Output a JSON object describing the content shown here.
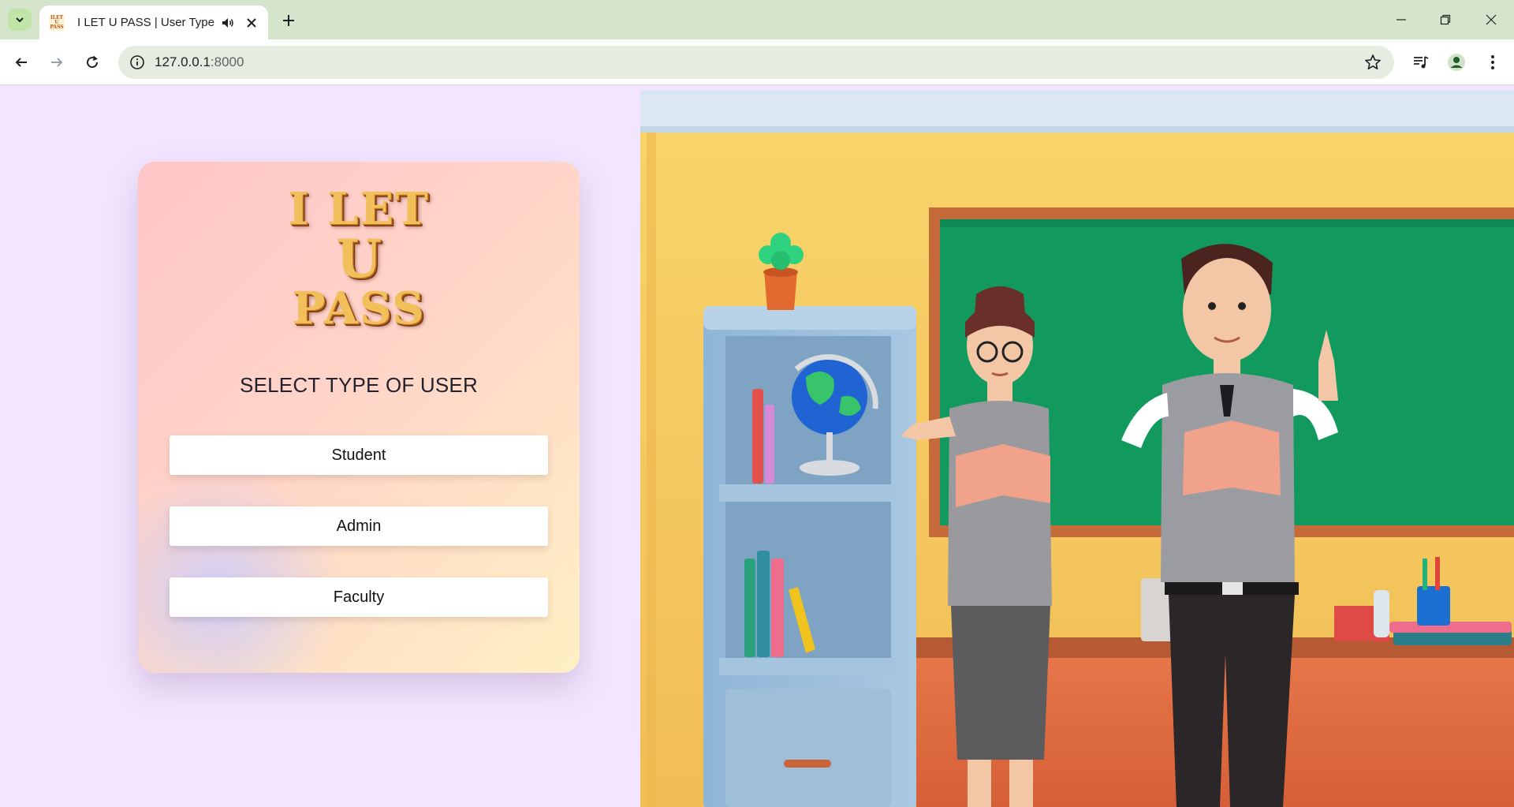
{
  "browser": {
    "tab_title": "I LET U PASS | User Type",
    "favicon_text": "I LET U PASS",
    "url_host": "127.0.0.1",
    "url_port": ":8000"
  },
  "card": {
    "logo_line1": "I LET",
    "logo_line2": "U",
    "logo_line3": "PASS",
    "heading": "SELECT TYPE OF USER",
    "buttons": [
      {
        "label": "Student"
      },
      {
        "label": "Admin"
      },
      {
        "label": "Faculty"
      }
    ]
  },
  "colors": {
    "page_bg": "#f3e5ff",
    "tabstrip_bg": "#d4e5cc",
    "omnibox_bg": "#e6ecdf",
    "logo_gold": "#f2c05a",
    "chalkboard": "#129a5e",
    "wall": "#f6cf63"
  },
  "icons": [
    "tab-search-icon",
    "audio-icon",
    "close-icon",
    "plus-icon",
    "minimize-icon",
    "restore-icon",
    "close-window-icon",
    "back-icon",
    "forward-icon",
    "reload-icon",
    "info-icon",
    "star-icon",
    "media-icon",
    "profile-icon",
    "menu-icon"
  ]
}
